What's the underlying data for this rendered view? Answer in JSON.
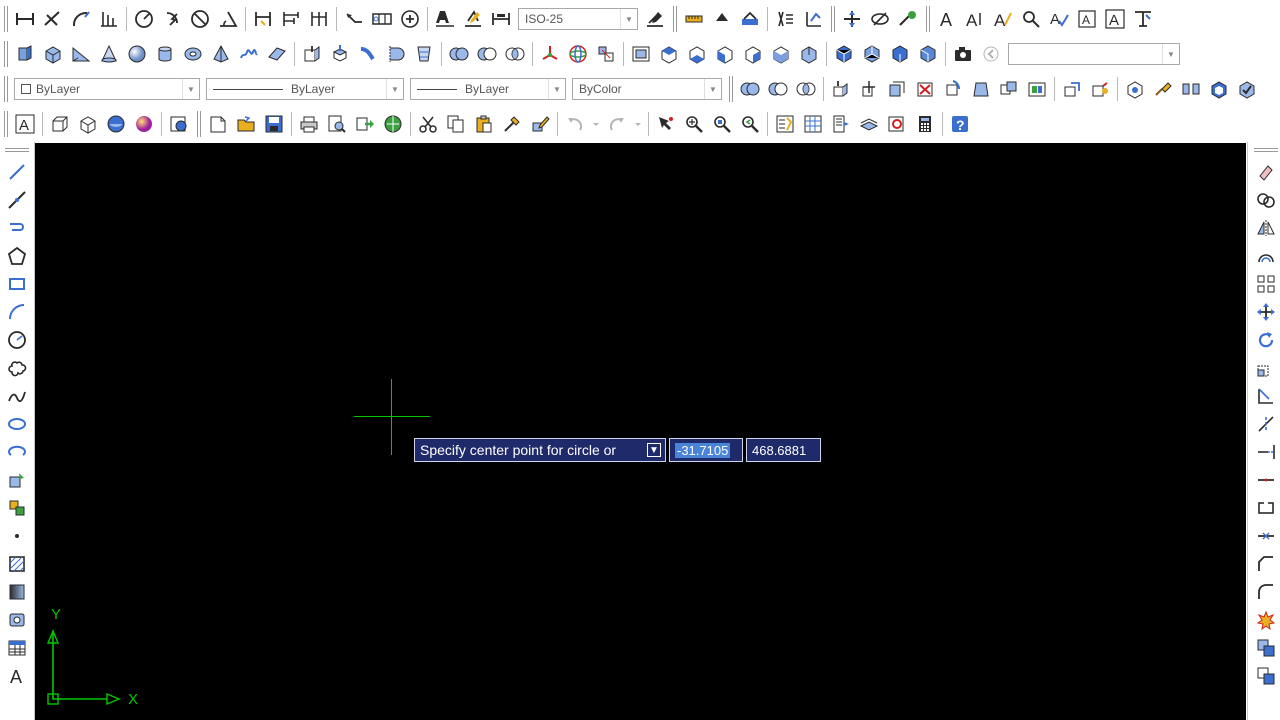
{
  "toolbars": {
    "dimstyle_combo": {
      "value": "ISO-25"
    },
    "search_combo": {
      "value": ""
    },
    "layer_combo": {
      "value": "ByLayer"
    },
    "linetype_combo": {
      "value": "ByLayer"
    },
    "lineweight_combo": {
      "value": "ByLayer"
    },
    "plotstyle_combo": {
      "value": "ByColor"
    }
  },
  "canvas": {
    "background": "#000000",
    "crosshair_color": "#00c800",
    "dynamic_input": {
      "prompt": "Specify center point for circle or",
      "x_value": "-31.7105",
      "y_value": "468.6881"
    },
    "ucs": {
      "x_label": "X",
      "y_label": "Y"
    }
  },
  "colors": {
    "toolbar_bg": "#ffffff",
    "prompt_bg": "#1f2a6b",
    "selection": "#4a84d8",
    "icon_blue": "#3a6fd0",
    "icon_dark": "#2b2b2b",
    "icon_yellow": "#e8b020",
    "icon_red": "#d02020"
  }
}
